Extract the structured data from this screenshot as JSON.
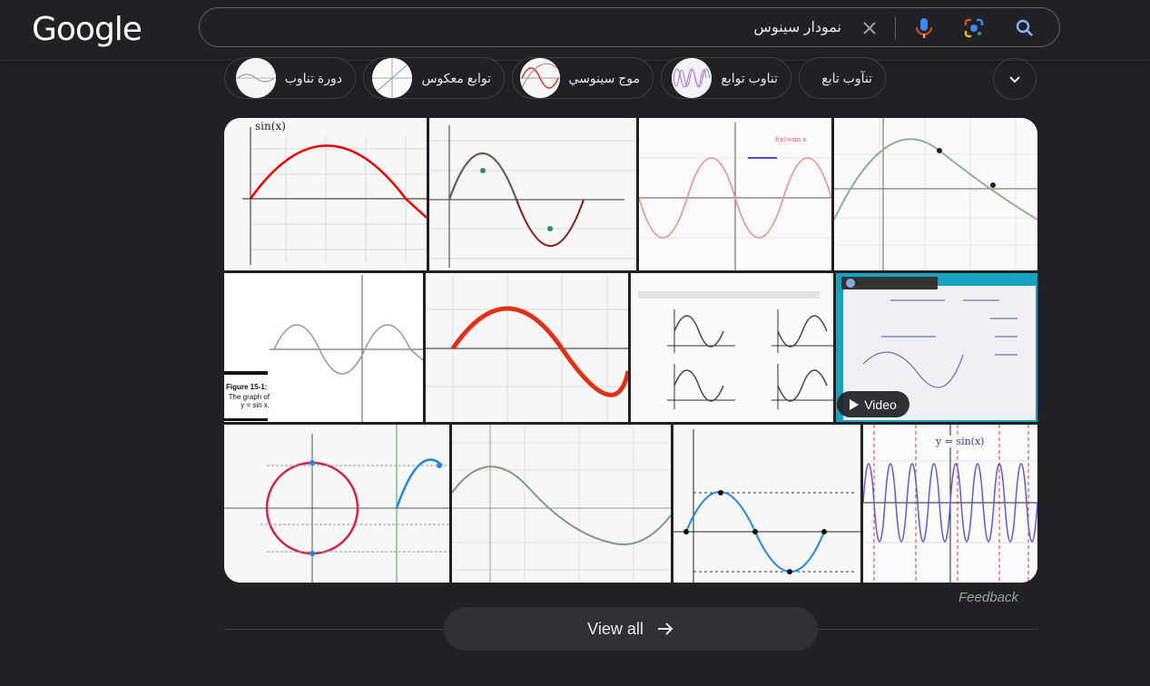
{
  "header": {
    "logo": "Google",
    "search_query": "نمودار سینوس"
  },
  "chips": [
    {
      "label": "تنآوب تابع"
    },
    {
      "label": "تناوب توابع"
    },
    {
      "label": "موج سينوسي"
    },
    {
      "label": "توابع معكوس"
    },
    {
      "label": "دورة تناوب"
    }
  ],
  "tiles": {
    "t1_ylabel": "sin(x)",
    "t5_caption_title": "Figure 15-1:",
    "t5_caption_body": "The graph of y = sin x.",
    "t12_title": "y = sin(x)",
    "video_label": "Video"
  },
  "footer": {
    "feedback": "Feedback",
    "view_all": "View all"
  },
  "icons": {
    "clear": "close-icon",
    "voice": "microphone-icon",
    "lens": "lens-icon",
    "search": "search-icon",
    "expand": "chevron-down-icon",
    "view_all_arrow": "arrow-right-icon",
    "play": "play-icon"
  }
}
